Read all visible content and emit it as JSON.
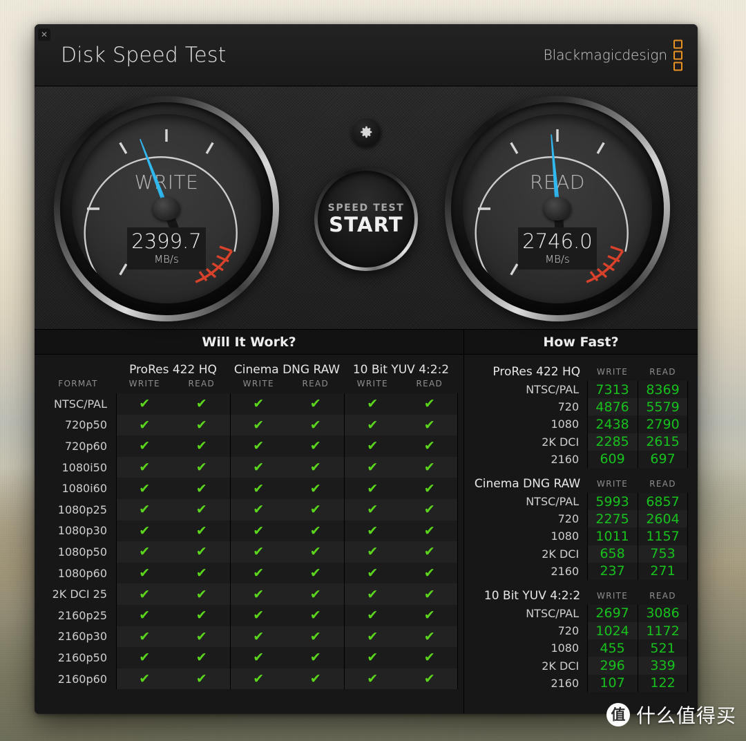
{
  "window": {
    "title": "Disk Speed Test",
    "close_label": "✕",
    "brand": "Blackmagicdesign"
  },
  "gauges": {
    "write": {
      "label": "WRITE",
      "value": "2399.7",
      "unit": "MB/s",
      "needle_deg": -21
    },
    "read": {
      "label": "READ",
      "value": "2746.0",
      "unit": "MB/s",
      "needle_deg": -5
    }
  },
  "controls": {
    "gear_icon": "gear-icon",
    "start_small": "SPEED TEST",
    "start_big": "START"
  },
  "will_it_work": {
    "title": "Will It Work?",
    "format_header": "FORMAT",
    "codec_groups": [
      "ProRes 422 HQ",
      "Cinema DNG RAW",
      "10 Bit YUV 4:2:2"
    ],
    "sub_headers": [
      "WRITE",
      "READ"
    ],
    "check_glyph": "✔",
    "rows": [
      {
        "format": "NTSC/PAL",
        "cells": [
          true,
          true,
          true,
          true,
          true,
          true
        ]
      },
      {
        "format": "720p50",
        "cells": [
          true,
          true,
          true,
          true,
          true,
          true
        ]
      },
      {
        "format": "720p60",
        "cells": [
          true,
          true,
          true,
          true,
          true,
          true
        ]
      },
      {
        "format": "1080i50",
        "cells": [
          true,
          true,
          true,
          true,
          true,
          true
        ]
      },
      {
        "format": "1080i60",
        "cells": [
          true,
          true,
          true,
          true,
          true,
          true
        ]
      },
      {
        "format": "1080p25",
        "cells": [
          true,
          true,
          true,
          true,
          true,
          true
        ]
      },
      {
        "format": "1080p30",
        "cells": [
          true,
          true,
          true,
          true,
          true,
          true
        ]
      },
      {
        "format": "1080p50",
        "cells": [
          true,
          true,
          true,
          true,
          true,
          true
        ]
      },
      {
        "format": "1080p60",
        "cells": [
          true,
          true,
          true,
          true,
          true,
          true
        ]
      },
      {
        "format": "2K DCI 25",
        "cells": [
          true,
          true,
          true,
          true,
          true,
          true
        ]
      },
      {
        "format": "2160p25",
        "cells": [
          true,
          true,
          true,
          true,
          true,
          true
        ]
      },
      {
        "format": "2160p30",
        "cells": [
          true,
          true,
          true,
          true,
          true,
          true
        ]
      },
      {
        "format": "2160p50",
        "cells": [
          true,
          true,
          true,
          true,
          true,
          true
        ]
      },
      {
        "format": "2160p60",
        "cells": [
          true,
          true,
          true,
          true,
          true,
          true
        ]
      }
    ]
  },
  "how_fast": {
    "title": "How Fast?",
    "col_write": "WRITE",
    "col_read": "READ",
    "groups": [
      {
        "name": "ProRes 422 HQ",
        "rows": [
          {
            "res": "NTSC/PAL",
            "write": "7313",
            "read": "8369"
          },
          {
            "res": "720",
            "write": "4876",
            "read": "5579"
          },
          {
            "res": "1080",
            "write": "2438",
            "read": "2790"
          },
          {
            "res": "2K DCI",
            "write": "2285",
            "read": "2615"
          },
          {
            "res": "2160",
            "write": "609",
            "read": "697"
          }
        ]
      },
      {
        "name": "Cinema DNG RAW",
        "rows": [
          {
            "res": "NTSC/PAL",
            "write": "5993",
            "read": "6857"
          },
          {
            "res": "720",
            "write": "2275",
            "read": "2604"
          },
          {
            "res": "1080",
            "write": "1011",
            "read": "1157"
          },
          {
            "res": "2K DCI",
            "write": "658",
            "read": "753"
          },
          {
            "res": "2160",
            "write": "237",
            "read": "271"
          }
        ]
      },
      {
        "name": "10 Bit YUV 4:2:2",
        "rows": [
          {
            "res": "NTSC/PAL",
            "write": "2697",
            "read": "3086"
          },
          {
            "res": "720",
            "write": "1024",
            "read": "1172"
          },
          {
            "res": "1080",
            "write": "455",
            "read": "521"
          },
          {
            "res": "2K DCI",
            "write": "296",
            "read": "339"
          },
          {
            "res": "2160",
            "write": "107",
            "read": "122"
          }
        ]
      }
    ]
  },
  "watermark": {
    "logo": "值",
    "text": "什么值得买"
  },
  "colors": {
    "needle": "#2fb6ee",
    "check": "#5bd61d",
    "number": "#17c21c",
    "brand_orange": "#e8921f",
    "redzone": "#d8412a"
  }
}
